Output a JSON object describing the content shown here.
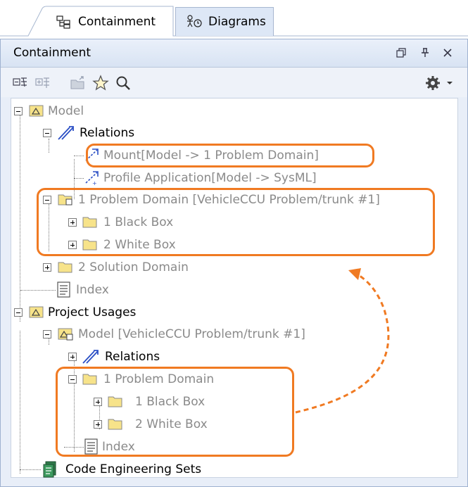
{
  "tabs": [
    {
      "label": "Containment",
      "icon": "containment-tree-icon",
      "active": true
    },
    {
      "label": "Diagrams",
      "icon": "diagrams-icon",
      "active": false
    }
  ],
  "panel": {
    "title": "Containment",
    "header_buttons": [
      "restore-icon",
      "pin-icon",
      "close-icon"
    ]
  },
  "toolbar": {
    "buttons": [
      "collapse-all-icon",
      "expand-all-icon",
      "open-folder-icon",
      "star-icon",
      "search-icon",
      "gear-icon",
      "dropdown-arrow-icon"
    ]
  },
  "tree": {
    "model": "Model",
    "relations_1": "Relations",
    "mount": "Mount[Model -> 1 Problem Domain]",
    "profile_application": "Profile Application[Model -> SysML]",
    "problem_domain_1": "1 Problem Domain [VehicleCCU Problem/trunk #1]",
    "black_box_1": "1 Black Box",
    "white_box_1": "2 White Box",
    "solution_domain": "2 Solution Domain",
    "index_1": "Index",
    "project_usages": "Project Usages",
    "model_usage": "Model [VehicleCCU Problem/trunk #1]",
    "relations_2": "Relations",
    "problem_domain_2": "1 Problem Domain",
    "black_box_2": "1 Black Box",
    "white_box_2": "2 White Box",
    "index_2": "Index",
    "code_engineering": "Code Engineering Sets"
  },
  "colors": {
    "highlight": "#f07a22",
    "panel_bg": "#e8eef8",
    "folder": "#f7e38a",
    "relation_arrow": "#2b4fc5"
  }
}
